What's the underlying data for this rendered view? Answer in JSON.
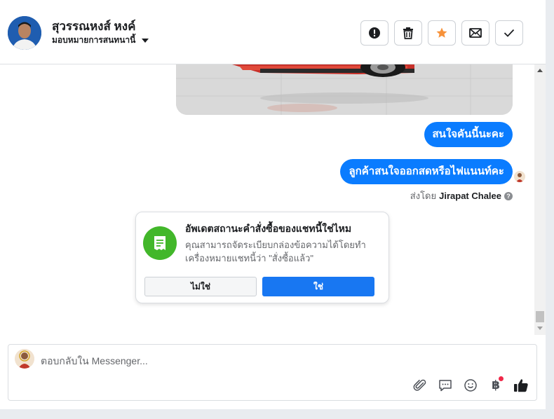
{
  "header": {
    "contact_name": "สุวรรณหงส์ หงค์",
    "assign_label": "มอบหมายการสนทนานี้",
    "actions": [
      "spam-button",
      "delete-button",
      "star-button",
      "mark-unread-button",
      "done-button"
    ],
    "star_color": "#f7923a"
  },
  "messages": [
    {
      "type": "image",
      "sender": "page"
    },
    {
      "type": "text",
      "sender": "page",
      "text": "สนใจคันนี้นะคะ"
    },
    {
      "type": "text",
      "sender": "page",
      "text": "ลูกค้าสนใจออกสดหรือไฟแนนท์คะ"
    }
  ],
  "sent_by": {
    "prefix": "ส่งโดย",
    "name": "Jirapat Chalee",
    "help_glyph": "?"
  },
  "order_card": {
    "title": "อัพเดตสถานะคำสั่งซื้อของแชทนี้ใช่ไหม",
    "body": "คุณสามารถจัดระเบียบกล่องข้อความได้โดยทำเครื่องหมายแชทนี้ว่า \"สั่งซื้อแล้ว\"",
    "no_label": "ไม่ใช่",
    "yes_label": "ใช่",
    "icon": "receipt-icon",
    "icon_color": "#42b72a",
    "yes_color": "#1877f2"
  },
  "composer": {
    "placeholder": "ตอบกลับใน Messenger...",
    "tools": [
      "attachment-icon",
      "saved-replies-icon",
      "emoji-icon",
      "payment-icon",
      "like-icon"
    ],
    "payment_glyph": "฿"
  },
  "bubble_color": "#0a7cff"
}
